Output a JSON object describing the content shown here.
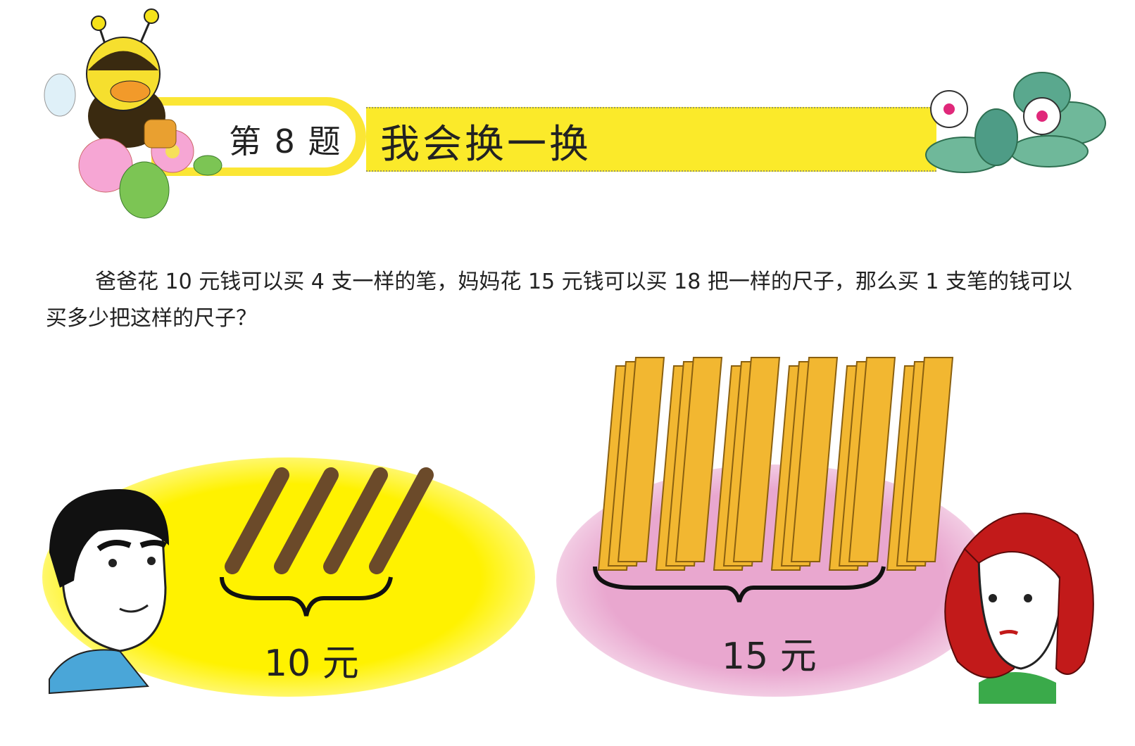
{
  "header": {
    "number_label": "第 8 题",
    "title": "我会换一换"
  },
  "question": "爸爸花 10 元钱可以买 4 支一样的笔，妈妈花 15 元钱可以买 18 把一样的尺子，那么买 1 支笔的钱可以买多少把这样的尺子？",
  "illustration": {
    "pens_price": "10 元",
    "rulers_price": "15 元",
    "pen_count": 4,
    "ruler_count": 18
  },
  "colors": {
    "yellow": "#fbea2a",
    "pink": "#e9a7cf",
    "pen": "#6b4a2a",
    "ruler": "#f2b731"
  }
}
